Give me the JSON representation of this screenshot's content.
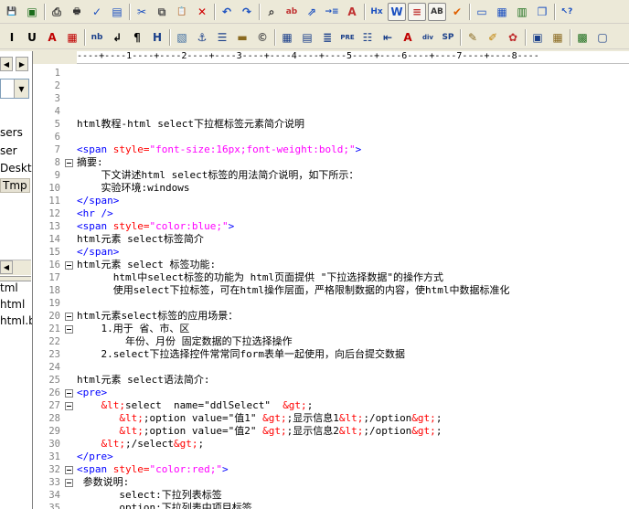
{
  "toolbar_row1": [
    {
      "icon": "save-icon",
      "glyph": "💾",
      "color": "#1b6d1b"
    },
    {
      "icon": "save-all-icon",
      "glyph": "▣",
      "color": "#1b6d1b"
    },
    {
      "icon": "print-preview-icon",
      "glyph": "⎙",
      "color": "#333"
    },
    {
      "icon": "print-icon",
      "glyph": "🖶",
      "color": "#333"
    },
    {
      "icon": "spellcheck-icon",
      "glyph": "✓",
      "color": "#1a4fc0"
    },
    {
      "icon": "find-in-files-icon",
      "glyph": "▤",
      "color": "#1a4fc0"
    },
    {
      "icon": "cut-icon",
      "glyph": "✂",
      "color": "#1a4fc0"
    },
    {
      "icon": "copy-icon",
      "glyph": "⧉",
      "color": "#555"
    },
    {
      "icon": "paste-icon",
      "glyph": "📋",
      "color": "#8a6a20"
    },
    {
      "icon": "delete-icon",
      "glyph": "✕",
      "color": "#d00000"
    },
    {
      "icon": "undo-icon",
      "glyph": "↶",
      "color": "#1a4fc0"
    },
    {
      "icon": "redo-icon",
      "glyph": "↷",
      "color": "#1a4fc0"
    },
    {
      "icon": "find-icon",
      "glyph": "⌕",
      "color": "#333"
    },
    {
      "icon": "replace-icon",
      "glyph": "ab",
      "color": "#c03030"
    },
    {
      "icon": "goto-icon",
      "glyph": "⇗",
      "color": "#1a4fc0"
    },
    {
      "icon": "insert-line-icon",
      "glyph": "→≡",
      "color": "#1a4fc0"
    },
    {
      "icon": "font-size-icon",
      "glyph": "A",
      "color": "#c03030"
    },
    {
      "icon": "html-toggle-icon",
      "glyph": "Hx",
      "color": "#1a4fc0"
    },
    {
      "icon": "word-wrap-icon",
      "glyph": "W",
      "color": "#1a4fc0"
    },
    {
      "icon": "line-wrap-icon",
      "glyph": "≡",
      "color": "#c03030"
    },
    {
      "icon": "spell-abcd-icon",
      "glyph": "AB",
      "color": "#333"
    },
    {
      "icon": "check-icon",
      "glyph": "✔",
      "color": "#e06000"
    },
    {
      "icon": "file-list-icon",
      "glyph": "▭",
      "color": "#1a4fc0"
    },
    {
      "icon": "directory-icon",
      "glyph": "▦",
      "color": "#1a4fc0"
    },
    {
      "icon": "clip-library-icon",
      "glyph": "▥",
      "color": "#1b6d1b"
    },
    {
      "icon": "window-icon",
      "glyph": "❐",
      "color": "#1a4fc0"
    },
    {
      "icon": "help-pointer-icon",
      "glyph": "↖?",
      "color": "#1a4fc0"
    }
  ],
  "toolbar_row2": [
    {
      "icon": "italic-icon",
      "glyph": "I",
      "color": "#000"
    },
    {
      "icon": "underline-icon",
      "glyph": "U",
      "color": "#000"
    },
    {
      "icon": "font-color-icon",
      "glyph": "A",
      "color": "#c00000"
    },
    {
      "icon": "color-grid-icon",
      "glyph": "▦",
      "color": "#c00000"
    },
    {
      "icon": "nbsp-icon",
      "glyph": "nb",
      "color": "#1a3f8a"
    },
    {
      "icon": "line-break-icon",
      "glyph": "↲",
      "color": "#000"
    },
    {
      "icon": "paragraph-icon",
      "glyph": "¶",
      "color": "#000"
    },
    {
      "icon": "heading-icon",
      "glyph": "H",
      "color": "#1a3f8a"
    },
    {
      "icon": "image-icon",
      "glyph": "▧",
      "color": "#3a6aa0"
    },
    {
      "icon": "anchor-icon",
      "glyph": "⚓",
      "color": "#1a3f8a"
    },
    {
      "icon": "align-left-icon",
      "glyph": "☰",
      "color": "#1a3f8a"
    },
    {
      "icon": "horizontal-rule-icon",
      "glyph": "▬",
      "color": "#8a6a20"
    },
    {
      "icon": "copyright-icon",
      "glyph": "©",
      "color": "#555"
    },
    {
      "icon": "table-icon",
      "glyph": "▦",
      "color": "#1a3f8a"
    },
    {
      "icon": "form-icon",
      "glyph": "▤",
      "color": "#1a3f8a"
    },
    {
      "icon": "center-icon",
      "glyph": "≣",
      "color": "#1a3f8a"
    },
    {
      "icon": "pre-icon",
      "glyph": "PRE",
      "color": "#1a3f8a"
    },
    {
      "icon": "list-icon",
      "glyph": "☷",
      "color": "#1a3f8a"
    },
    {
      "icon": "outdent-icon",
      "glyph": "⇤",
      "color": "#1a3f8a"
    },
    {
      "icon": "font-tag-icon",
      "glyph": "A",
      "color": "#c00000"
    },
    {
      "icon": "div-icon",
      "glyph": "div",
      "color": "#1a3f8a"
    },
    {
      "icon": "span-icon",
      "glyph": "SP",
      "color": "#1a3f8a"
    },
    {
      "icon": "edit-icon",
      "glyph": "✎",
      "color": "#8a6a20"
    },
    {
      "icon": "highlight-icon",
      "glyph": "✐",
      "color": "#c08000"
    },
    {
      "icon": "palette-icon",
      "glyph": "✿",
      "color": "#c03030"
    },
    {
      "icon": "frame-icon",
      "glyph": "▣",
      "color": "#1a3f8a"
    },
    {
      "icon": "grid-icon",
      "glyph": "▦",
      "color": "#8a6a20"
    },
    {
      "icon": "color-picker-icon",
      "glyph": "▩",
      "color": "#1b6d1b"
    },
    {
      "icon": "view-icon",
      "glyph": "▢",
      "color": "#1a3f8a"
    }
  ],
  "left_panel": {
    "items": [
      "sers",
      "ser",
      "Deskt",
      "Tmp"
    ],
    "selected": "Tmp",
    "files": [
      "tml",
      "html",
      "html.b"
    ]
  },
  "ruler": "----+----1----+----2----+----3----+----4----+----5----+----6----+----7----+----8----",
  "lines": [
    {
      "n": "1",
      "fold": false,
      "parts": []
    },
    {
      "n": "2",
      "fold": false,
      "parts": []
    },
    {
      "n": "3",
      "fold": false,
      "parts": []
    },
    {
      "n": "4",
      "fold": false,
      "parts": []
    },
    {
      "n": "5",
      "fold": false,
      "parts": [
        [
          "plain",
          "html教程-html select下拉框标签元素简介说明"
        ]
      ]
    },
    {
      "n": "6",
      "fold": false,
      "parts": []
    },
    {
      "n": "7",
      "fold": false,
      "parts": [
        [
          "tag",
          "<span "
        ],
        [
          "attr",
          "style="
        ],
        [
          "val",
          "\"font-size:16px;font-weight:bold;\""
        ],
        [
          "tag",
          ">"
        ]
      ]
    },
    {
      "n": "8",
      "fold": true,
      "parts": [
        [
          "plain",
          "摘要:"
        ]
      ]
    },
    {
      "n": "9",
      "fold": false,
      "parts": [
        [
          "plain",
          "    下文讲述html select标签的用法简介说明，如下所示："
        ]
      ]
    },
    {
      "n": "10",
      "fold": false,
      "parts": [
        [
          "plain",
          "    实验环境:windows"
        ]
      ]
    },
    {
      "n": "11",
      "fold": false,
      "parts": [
        [
          "tag",
          "</span>"
        ]
      ]
    },
    {
      "n": "12",
      "fold": false,
      "parts": [
        [
          "tag",
          "<hr />"
        ]
      ]
    },
    {
      "n": "13",
      "fold": false,
      "parts": [
        [
          "tag",
          "<span "
        ],
        [
          "attr",
          "style="
        ],
        [
          "val",
          "\"color:blue;\""
        ],
        [
          "tag",
          ">"
        ]
      ]
    },
    {
      "n": "14",
      "fold": false,
      "parts": [
        [
          "plain",
          "html元素 select标签简介"
        ]
      ]
    },
    {
      "n": "15",
      "fold": false,
      "parts": [
        [
          "tag",
          "</span>"
        ]
      ]
    },
    {
      "n": "16",
      "fold": true,
      "parts": [
        [
          "plain",
          "html元素 select 标签功能:"
        ]
      ]
    },
    {
      "n": "17",
      "fold": false,
      "parts": [
        [
          "plain",
          "      html中select标签的功能为 html页面提供 \"下拉选择数据\"的操作方式"
        ]
      ]
    },
    {
      "n": "18",
      "fold": false,
      "parts": [
        [
          "plain",
          "      使用select下拉标签，可在html操作层面，严格限制数据的内容，使html中数据标准化"
        ]
      ]
    },
    {
      "n": "19",
      "fold": false,
      "parts": []
    },
    {
      "n": "20",
      "fold": true,
      "parts": [
        [
          "plain",
          "html元素select标签的应用场景："
        ]
      ]
    },
    {
      "n": "21",
      "fold": true,
      "parts": [
        [
          "plain",
          "    1.用于 省、市、区"
        ]
      ]
    },
    {
      "n": "22",
      "fold": false,
      "parts": [
        [
          "plain",
          "        年份、月份 固定数据的下拉选择操作"
        ]
      ]
    },
    {
      "n": "23",
      "fold": false,
      "parts": [
        [
          "plain",
          "    2.select下拉选择控件常常同form表单一起使用，向后台提交数据"
        ]
      ]
    },
    {
      "n": "24",
      "fold": false,
      "parts": []
    },
    {
      "n": "25",
      "fold": false,
      "parts": [
        [
          "plain",
          "html元素 select语法简介:"
        ]
      ]
    },
    {
      "n": "26",
      "fold": true,
      "parts": [
        [
          "tag",
          "<pre>"
        ]
      ]
    },
    {
      "n": "27",
      "fold": true,
      "parts": [
        [
          "plain",
          "    "
        ],
        [
          "ent",
          "&lt;"
        ],
        [
          "plain",
          "select  name=\"ddlSelect\"  "
        ],
        [
          "ent",
          "&gt;"
        ],
        [
          "plain",
          ";"
        ]
      ]
    },
    {
      "n": "28",
      "fold": false,
      "parts": [
        [
          "plain",
          "       "
        ],
        [
          "ent",
          "&lt;"
        ],
        [
          "plain",
          ";option value=\"值1\" "
        ],
        [
          "ent",
          "&gt;"
        ],
        [
          "plain",
          ";显示信息1"
        ],
        [
          "ent",
          "&lt;"
        ],
        [
          "plain",
          ";/option"
        ],
        [
          "ent",
          "&gt;"
        ],
        [
          "plain",
          ";"
        ]
      ]
    },
    {
      "n": "29",
      "fold": false,
      "parts": [
        [
          "plain",
          "       "
        ],
        [
          "ent",
          "&lt;"
        ],
        [
          "plain",
          ";option value=\"值2\" "
        ],
        [
          "ent",
          "&gt;"
        ],
        [
          "plain",
          ";显示信息2"
        ],
        [
          "ent",
          "&lt;"
        ],
        [
          "plain",
          ";/option"
        ],
        [
          "ent",
          "&gt;"
        ],
        [
          "plain",
          ";"
        ]
      ]
    },
    {
      "n": "30",
      "fold": false,
      "parts": [
        [
          "plain",
          "    "
        ],
        [
          "ent",
          "&lt;"
        ],
        [
          "plain",
          ";/select"
        ],
        [
          "ent",
          "&gt;"
        ],
        [
          "plain",
          ";"
        ]
      ]
    },
    {
      "n": "31",
      "fold": false,
      "parts": [
        [
          "tag",
          "</pre>"
        ]
      ]
    },
    {
      "n": "32",
      "fold": true,
      "parts": [
        [
          "tag",
          "<span "
        ],
        [
          "attr",
          "style="
        ],
        [
          "val",
          "\"color:red;\""
        ],
        [
          "tag",
          ">"
        ]
      ]
    },
    {
      "n": "33",
      "fold": true,
      "parts": [
        [
          "plain",
          " 参数说明:"
        ]
      ]
    },
    {
      "n": "34",
      "fold": false,
      "parts": [
        [
          "plain",
          "       select:下拉列表标签"
        ]
      ]
    },
    {
      "n": "35",
      "fold": false,
      "parts": [
        [
          "plain",
          "       option:下拉列表中项目标签"
        ]
      ]
    }
  ]
}
